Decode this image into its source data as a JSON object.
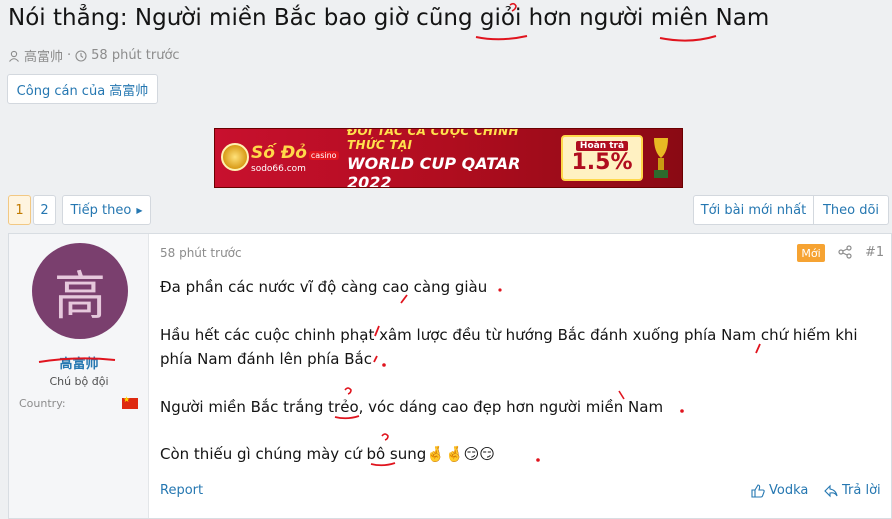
{
  "thread": {
    "title": "Nói thẳng: Người miền Bắc bao giờ cũng giỏi hơn người miên Nam",
    "author": "高富帅",
    "time": "58 phút trước",
    "author_button": "Công cán của 高富帅"
  },
  "banner": {
    "brand": "Số Đỏ",
    "brand_badge": "casino",
    "site": "sodo66.com",
    "line1": "ĐỐI TÁC CÁ CƯỢC CHÍNH THỨC TẠI",
    "line2": "WORLD CUP QATAR 2022",
    "cash_label": "Hoàn trả",
    "cash_value": "1.5%"
  },
  "pagination": {
    "pages": [
      "1",
      "2"
    ],
    "current": "1",
    "next_label": "Tiếp theo"
  },
  "toolbar": {
    "newest_label": "Tới bài mới nhất",
    "follow_label": "Theo dõi"
  },
  "post": {
    "user": {
      "avatar_letter": "高",
      "name": "高富帅",
      "role": "Chú bộ đội",
      "country_label": "Country:"
    },
    "time": "58 phút trước",
    "badge": "Mới",
    "number": "#1",
    "paragraphs": [
      "Đa phần các nước vĩ độ càng cao càng giàu",
      "Hầu hết các cuộc chinh phạt xâm lược đều từ hướng Bắc đánh xuống phía Nam chứ hiếm khi phía Nam đánh lên phía Bắc",
      "Người miền Bắc trắng trẻo, vóc dáng cao đẹp hơn người miền Nam",
      "Còn thiếu gì chúng mày cứ bô sung🤞🤞😏😏"
    ],
    "report_label": "Report",
    "react_label": "Vodka",
    "reply_label": "Trả lời"
  },
  "colors": {
    "link": "#2577b1",
    "accent_badge": "#f6a332",
    "avatar_bg": "#7a3f6e",
    "annotation_red": "#e0141e"
  }
}
